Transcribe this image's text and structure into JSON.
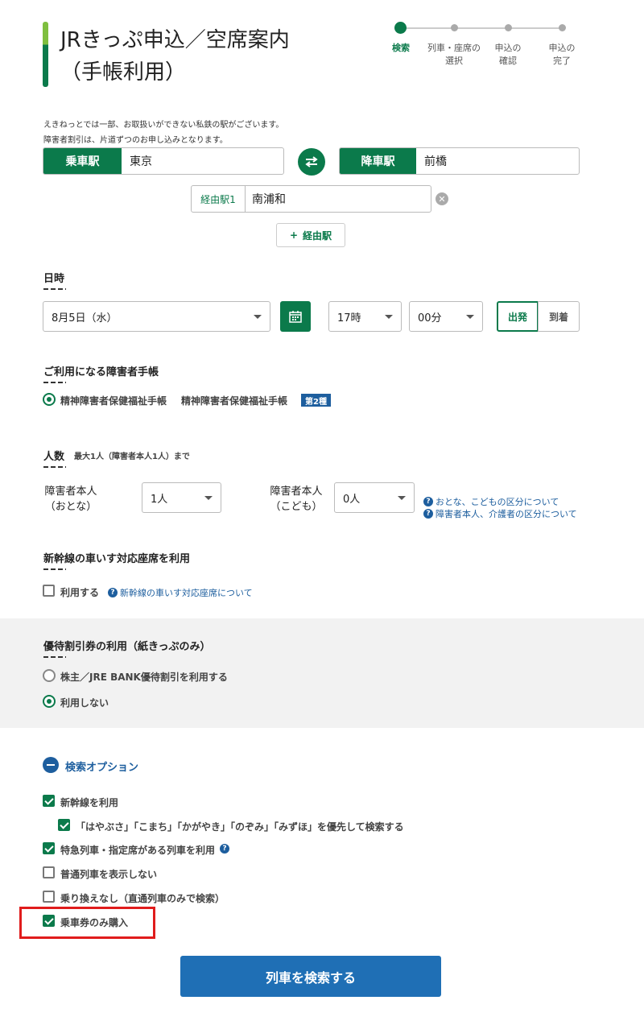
{
  "header": {
    "title_line1": "JRきっぷ申込／空席案内",
    "title_line2": "（手帳利用）"
  },
  "steps": [
    {
      "label_line1": "検索",
      "label_line2": "",
      "active": true
    },
    {
      "label_line1": "列車・座席の",
      "label_line2": "選択",
      "active": false
    },
    {
      "label_line1": "申込の",
      "label_line2": "確認",
      "active": false
    },
    {
      "label_line1": "申込の",
      "label_line2": "完了",
      "active": false
    }
  ],
  "notes": [
    "えきねっとでは一部、お取扱いができない私鉄の駅がございます。",
    "障害者割引は、片道ずつのお申し込みとなります。"
  ],
  "stations": {
    "departure_label": "乗車駅",
    "departure_value": "東京",
    "arrival_label": "降車駅",
    "arrival_value": "前橋",
    "via_label": "経由駅1",
    "via_value": "南浦和",
    "add_via_label": "経由駅"
  },
  "datetime": {
    "heading": "日時",
    "date_value": "8月5日（水）",
    "hour_value": "17時",
    "minute_value": "00分",
    "depart_label": "出発",
    "arrive_label": "到着"
  },
  "handbook": {
    "heading": "ご利用になる障害者手帳",
    "option_label": "精神障害者保健福祉手帳",
    "option_detail": "精神障害者保健福祉手帳",
    "badge": "第2種"
  },
  "people": {
    "heading": "人数",
    "heading_note": "最大1人（障害者本人1人）まで",
    "adult_label_line1": "障害者本人",
    "adult_label_line2": "（おとな）",
    "adult_value": "1人",
    "child_label_line1": "障害者本人",
    "child_label_line2": "（こども）",
    "child_value": "0人",
    "help1": "おとな、こどもの区分について",
    "help2": "障害者本人、介護者の区分について"
  },
  "wheelchair": {
    "heading": "新幹線の車いす対応座席を利用",
    "checkbox_label": "利用する",
    "help": "新幹線の車いす対応座席について"
  },
  "discount": {
    "heading": "優待割引券の利用（紙きっぷのみ）",
    "option1": "株主／JRE BANK優待割引を利用する",
    "option2": "利用しない"
  },
  "search_options": {
    "toggle_label": "検索オプション",
    "items": [
      {
        "label": "新幹線を利用",
        "checked": true
      },
      {
        "label": "「はやぶさ」「こまち」「かがやき」「のぞみ」「みずほ」を優先して検索する",
        "checked": true
      },
      {
        "label": "特急列車・指定席がある列車を利用",
        "checked": true
      },
      {
        "label": "普通列車を表示しない",
        "checked": false
      },
      {
        "label": "乗り換えなし（直通列車のみで検索）",
        "checked": false
      },
      {
        "label": "乗車券のみ購入",
        "checked": true
      }
    ]
  },
  "search_button": "列車を検索する",
  "colors": {
    "brand_green": "#0b7a4b",
    "link_blue": "#1d5e9e",
    "button_blue": "#1f6fb5",
    "highlight_red": "#e01c1c"
  }
}
